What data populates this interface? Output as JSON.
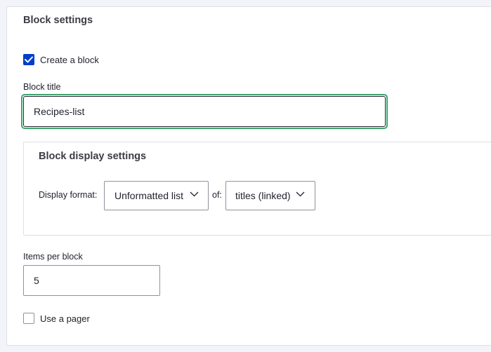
{
  "block_settings": {
    "title": "Block settings",
    "create_block": {
      "label": "Create a block",
      "checked": true
    },
    "block_title": {
      "label": "Block title",
      "value": "Recipes-list"
    },
    "display_settings": {
      "title": "Block display settings",
      "display_format_label": "Display format:",
      "display_format_value": "Unformatted list",
      "of_label": "of:",
      "of_value": "titles (linked)"
    },
    "items_per_block": {
      "label": "Items per block",
      "value": "5"
    },
    "use_pager": {
      "label": "Use a pager",
      "checked": false
    }
  },
  "colors": {
    "checkbox_checked": "#003ecc",
    "focus_ring": "#3ca56f",
    "panel_border": "#dedfe4",
    "background": "#f3f4f9"
  },
  "icons": [
    "check-icon",
    "chevron-down-icon"
  ]
}
